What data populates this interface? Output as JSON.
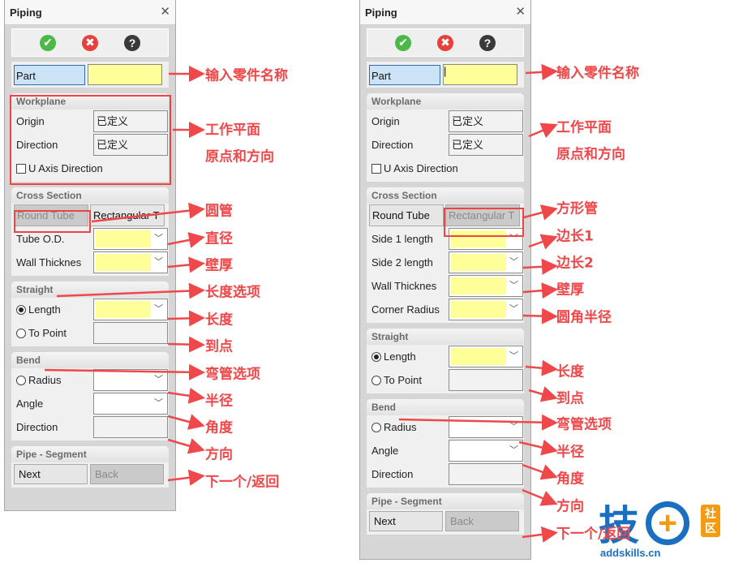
{
  "panels": [
    {
      "title": "Piping",
      "toolbar": [
        "ok",
        "cancel",
        "help"
      ],
      "part": {
        "label": "Part",
        "value": ""
      },
      "sections": [
        {
          "title": "Workplane",
          "rows": [
            {
              "type": "field",
              "label": "Origin",
              "value": "已定义"
            },
            {
              "type": "field",
              "label": "Direction",
              "value": "已定义"
            },
            {
              "type": "checkbox",
              "label": "U Axis Direction",
              "checked": false
            }
          ]
        },
        {
          "title": "Cross Section",
          "rows": [
            {
              "type": "tabs",
              "tabs": [
                "Round Tube",
                "Rectangular T"
              ],
              "selected": 0
            },
            {
              "type": "combo",
              "label": "Tube O.D.",
              "yellow": true
            },
            {
              "type": "combo",
              "label": "Wall Thicknes",
              "yellow": true
            }
          ]
        },
        {
          "title": "Straight",
          "rows": [
            {
              "type": "combo",
              "label": "Length",
              "radio": true,
              "checked": true,
              "yellow": true
            },
            {
              "type": "field",
              "label": "To Point",
              "radio": true,
              "checked": false,
              "value": ""
            }
          ]
        },
        {
          "title": "Bend",
          "rows": [
            {
              "type": "combo",
              "label": "Radius",
              "radio": true,
              "checked": false,
              "yellow": false
            },
            {
              "type": "combo",
              "label": "Angle",
              "yellow": false
            },
            {
              "type": "field",
              "label": "Direction",
              "value": ""
            }
          ]
        },
        {
          "title": "Pipe - Segment",
          "rows": [
            {
              "type": "buttons",
              "buttons": [
                "Next",
                "Back"
              ],
              "disabled": [
                false,
                true
              ]
            }
          ]
        }
      ]
    },
    {
      "title": "Piping",
      "toolbar": [
        "ok",
        "cancel",
        "help"
      ],
      "part": {
        "label": "Part",
        "value": "|"
      },
      "sections": [
        {
          "title": "Workplane",
          "rows": [
            {
              "type": "field",
              "label": "Origin",
              "value": "已定义"
            },
            {
              "type": "field",
              "label": "Direction",
              "value": "已定义"
            },
            {
              "type": "checkbox",
              "label": "U Axis Direction",
              "checked": false
            }
          ]
        },
        {
          "title": "Cross Section",
          "rows": [
            {
              "type": "tabs",
              "tabs": [
                "Round Tube",
                "Rectangular T"
              ],
              "selected": 1
            },
            {
              "type": "combo",
              "label": "Side 1 length",
              "yellow": true
            },
            {
              "type": "combo",
              "label": "Side 2 length",
              "yellow": true
            },
            {
              "type": "combo",
              "label": "Wall Thicknes",
              "yellow": true
            },
            {
              "type": "combo",
              "label": "Corner Radius",
              "yellow": true
            }
          ]
        },
        {
          "title": "Straight",
          "rows": [
            {
              "type": "combo",
              "label": "Length",
              "radio": true,
              "checked": true,
              "yellow": true
            },
            {
              "type": "field",
              "label": "To Point",
              "radio": true,
              "checked": false,
              "value": ""
            }
          ]
        },
        {
          "title": "Bend",
          "rows": [
            {
              "type": "combo",
              "label": "Radius",
              "radio": true,
              "checked": false,
              "yellow": false
            },
            {
              "type": "combo",
              "label": "Angle",
              "yellow": false
            },
            {
              "type": "field",
              "label": "Direction",
              "value": ""
            }
          ]
        },
        {
          "title": "Pipe - Segment",
          "rows": [
            {
              "type": "buttons",
              "buttons": [
                "Next",
                "Back"
              ],
              "disabled": [
                false,
                true
              ]
            }
          ]
        }
      ]
    }
  ],
  "annotations_left": [
    "输入零件名称",
    "工作平面",
    "原点和方向",
    "圆管",
    "直径",
    "壁厚",
    "长度选项",
    "长度",
    "到点",
    "弯管选项",
    "半径",
    "角度",
    "方向",
    "下一个/返回"
  ],
  "annotations_right": [
    "输入零件名称",
    "工作平面",
    "原点和方向",
    "方形管",
    "边长1",
    "边长2",
    "壁厚",
    "圆角半径",
    "长度",
    "到点",
    "弯管选项",
    "半径",
    "角度",
    "方向",
    "下一个/返回"
  ],
  "logo": {
    "char": "技",
    "badge": "社区",
    "site": "addskills.cn"
  },
  "colors": {
    "annotation": "#f0484a",
    "ok": "#4cb848",
    "cancel": "#e8413c",
    "help": "#3a3a3a",
    "required_field": "#ffff99",
    "logo_blue": "#1a6fc0",
    "logo_orange": "#f39c12"
  }
}
